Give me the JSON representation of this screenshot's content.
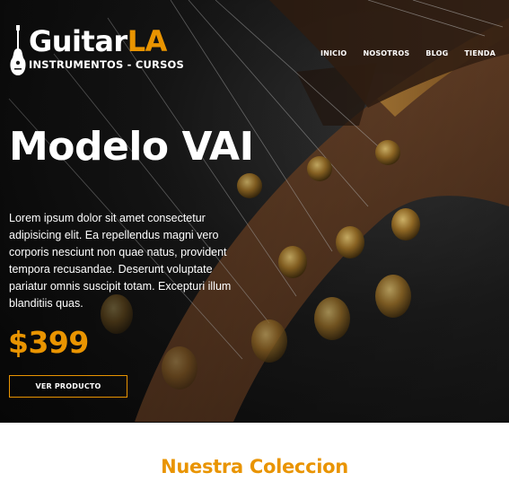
{
  "header": {
    "logo": {
      "title_main": "Guitar",
      "title_accent": "LA",
      "subtitle": "INSTRUMENTOS - CURSOS",
      "icon": "guitar-icon"
    },
    "nav": [
      {
        "label": "INICIO"
      },
      {
        "label": "NOSOTROS"
      },
      {
        "label": "BLOG"
      },
      {
        "label": "TIENDA"
      }
    ]
  },
  "hero": {
    "title": "Modelo VAI",
    "description": "Lorem ipsum dolor sit amet consectetur adipisicing elit. Ea repellendus magni vero corporis nesciunt non quae natus, provident tempora recusandae. Deserunt voluptate pariatur omnis suscipit totam. Excepturi illum blanditiis quas.",
    "price": "$399",
    "cta_label": "VER PRODUCTO"
  },
  "collection": {
    "title": "Nuestra Coleccion"
  },
  "colors": {
    "accent": "#e99401",
    "hero_background": "#1a1a1a",
    "text_light": "#ffffff"
  }
}
